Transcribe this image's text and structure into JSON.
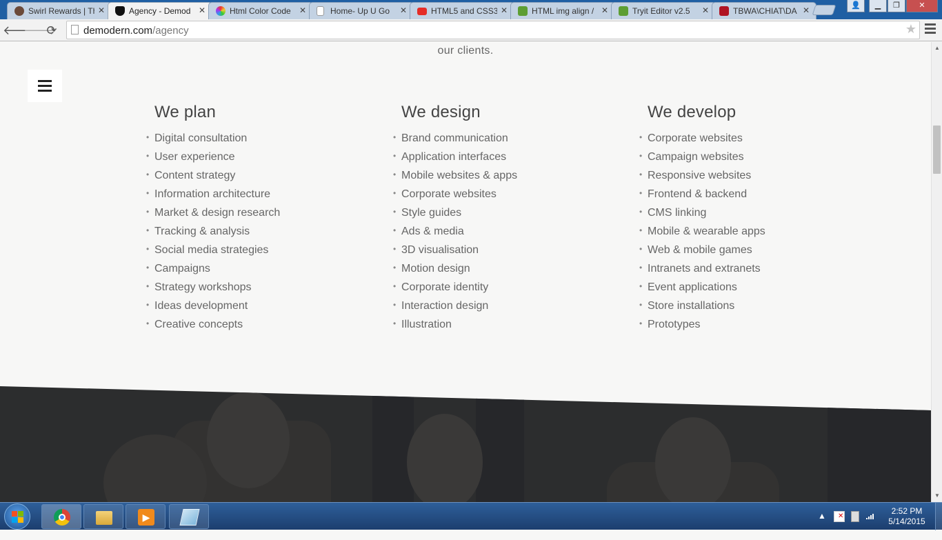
{
  "browser": {
    "tabs": [
      {
        "title": "Swirl Rewards | Th",
        "icon": "swirl-icon",
        "active": false
      },
      {
        "title": "Agency - Demod",
        "icon": "shield-icon",
        "active": true
      },
      {
        "title": "Html Color Code",
        "icon": "color-wheel-icon",
        "active": false
      },
      {
        "title": "Home- Up U Go",
        "icon": "page-icon",
        "active": false
      },
      {
        "title": "HTML5 and CSS3",
        "icon": "youtube-icon",
        "active": false
      },
      {
        "title": "HTML img align /",
        "icon": "w3schools-icon",
        "active": false
      },
      {
        "title": "Tryit Editor v2.5",
        "icon": "w3schools-icon",
        "active": false
      },
      {
        "title": "TBWA\\CHIAT\\DA",
        "icon": "tbwa-icon",
        "active": false
      }
    ],
    "url_domain": "demodern.com",
    "url_path": "/agency"
  },
  "page": {
    "intro_tail": "our clients.",
    "columns": [
      {
        "heading": "We plan",
        "items": [
          "Digital consultation",
          "User experience",
          "Content strategy",
          "Information architecture",
          "Market & design research",
          "Tracking & analysis",
          "Social media strategies",
          "Campaigns",
          "Strategy workshops",
          "Ideas development",
          "Creative concepts"
        ]
      },
      {
        "heading": "We design",
        "items": [
          "Brand communication",
          "Application interfaces",
          "Mobile websites & apps",
          "Corporate websites",
          "Style guides",
          "Ads & media",
          "3D visualisation",
          "Motion design",
          "Corporate identity",
          "Interaction design",
          "Illustration"
        ]
      },
      {
        "heading": "We develop",
        "items": [
          "Corporate websites",
          "Campaign websites",
          "Responsive websites",
          "Frontend & backend",
          "CMS linking",
          "Mobile & wearable apps",
          "Web & mobile games",
          "Intranets and extranets",
          "Event applications",
          "Store installations",
          "Prototypes"
        ]
      }
    ]
  },
  "taskbar": {
    "apps": [
      {
        "name": "chrome-icon"
      },
      {
        "name": "file-explorer-icon"
      },
      {
        "name": "media-player-icon"
      },
      {
        "name": "notepad-icon"
      }
    ],
    "time": "2:52 PM",
    "date": "5/14/2015"
  }
}
